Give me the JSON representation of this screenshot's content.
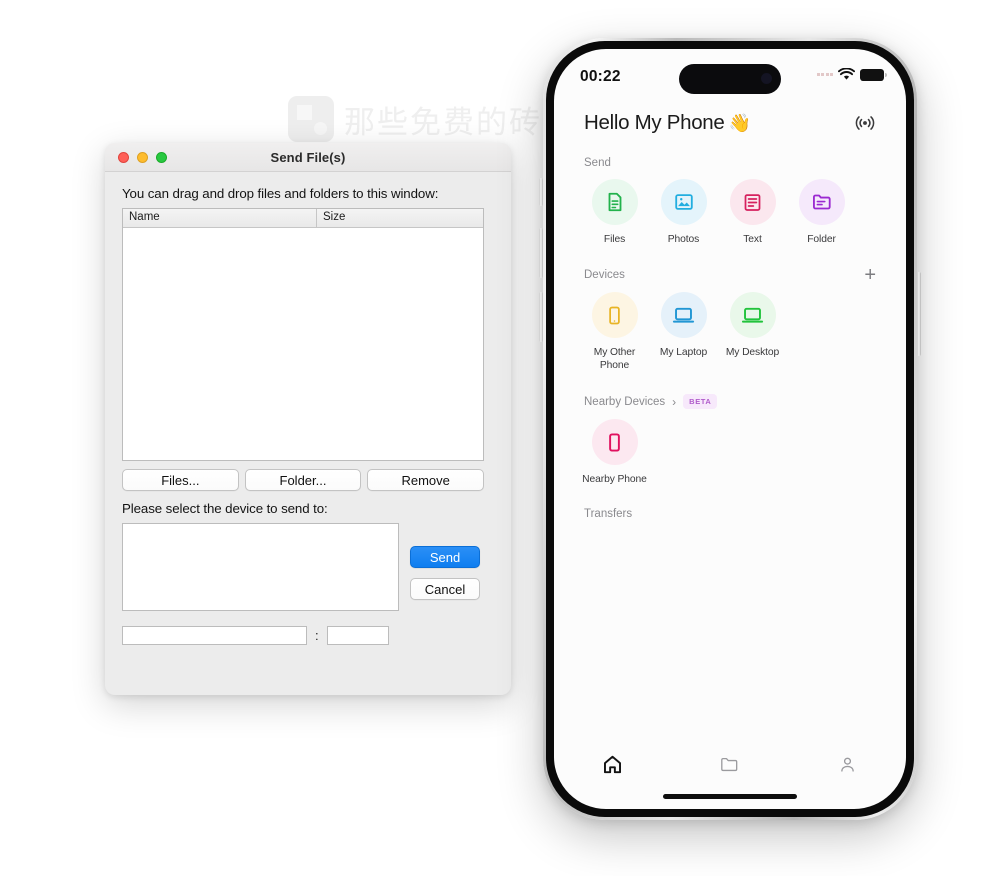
{
  "watermark": {
    "text": "那些免费的砖",
    "logo_icon": "brick-logo-icon"
  },
  "mac_window": {
    "title": "Send File(s)",
    "traffic_lights": [
      {
        "name": "close",
        "color": "#ff5f57"
      },
      {
        "name": "minimize",
        "color": "#febc2e"
      },
      {
        "name": "zoom",
        "color": "#28c840"
      }
    ],
    "drag_hint": "You can drag and drop files and folders to this window:",
    "file_table": {
      "columns": [
        "Name",
        "Size"
      ],
      "rows": []
    },
    "buttons": {
      "files": "Files...",
      "folder": "Folder...",
      "remove": "Remove",
      "send": "Send",
      "cancel": "Cancel"
    },
    "select_device_label": "Please select the device to send to:",
    "device_list": {
      "items": []
    },
    "address": {
      "host_value": "",
      "port_value": "",
      "separator": ":"
    },
    "accent_color": "#1a82f5"
  },
  "phone": {
    "status_bar": {
      "time": "00:22",
      "signal_icon": "signal-dots-icon",
      "wifi_icon": "wifi-icon",
      "battery_icon": "battery-full-icon"
    },
    "header": {
      "title": "Hello My Phone",
      "emoji": "👋",
      "action_icon": "broadcast-radar-icon"
    },
    "sections": [
      {
        "id": "send",
        "label": "Send",
        "tiles": [
          {
            "label": "Files",
            "icon": "file-document-icon",
            "color": "#22b24c",
            "bg": "#e9f8ee"
          },
          {
            "label": "Photos",
            "icon": "image-photo-icon",
            "color": "#22aee0",
            "bg": "#e4f4fb"
          },
          {
            "label": "Text",
            "icon": "text-lines-icon",
            "color": "#d6215e",
            "bg": "#fbe7ee"
          },
          {
            "label": "Folder",
            "icon": "folder-icon",
            "color": "#9b2ad1",
            "bg": "#f5e9fb"
          }
        ]
      },
      {
        "id": "devices",
        "label": "Devices",
        "action_icon": "plus-icon",
        "action_label": "+",
        "tiles": [
          {
            "label": "My Other Phone",
            "icon": "smartphone-icon",
            "color": "#e8b425",
            "bg": "#fdf5e3"
          },
          {
            "label": "My Laptop",
            "icon": "laptop-icon",
            "color": "#2196d4",
            "bg": "#e5f1fa"
          },
          {
            "label": "My Desktop",
            "icon": "desktop-icon",
            "color": "#22c33c",
            "bg": "#e9f8ea"
          }
        ]
      },
      {
        "id": "nearby",
        "label": "Nearby Devices",
        "chevron": "›",
        "badge": "BETA",
        "badge_color": "#b05ccb",
        "tiles": [
          {
            "label": "Nearby Phone",
            "icon": "smartphone-icon",
            "color": "#e0115f",
            "bg": "#fce8f0"
          }
        ]
      },
      {
        "id": "transfers",
        "label": "Transfers",
        "tiles": []
      }
    ],
    "tabbar": [
      {
        "id": "home",
        "icon": "home-icon",
        "active": true
      },
      {
        "id": "files",
        "icon": "folder-icon",
        "active": false
      },
      {
        "id": "profile",
        "icon": "person-icon",
        "active": false
      }
    ]
  }
}
